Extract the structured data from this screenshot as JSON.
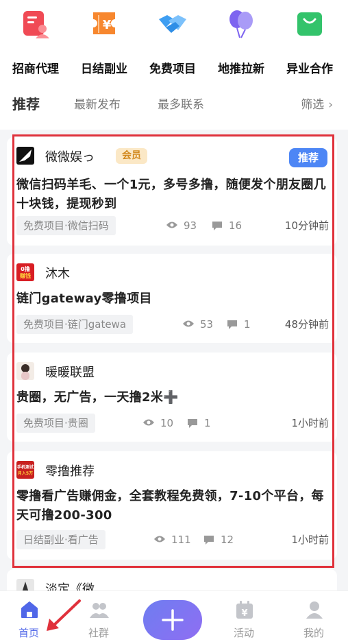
{
  "categories": [
    {
      "label": "招商代理",
      "icon": "merchant-agent-icon",
      "color": "#f04a55"
    },
    {
      "label": "日结副业",
      "icon": "daily-pay-ticket-icon",
      "color": "#f7872e"
    },
    {
      "label": "免费项目",
      "icon": "handshake-icon",
      "color": "#3e9ef2"
    },
    {
      "label": "地推拉新",
      "icon": "balloons-icon",
      "color": "#7d64f0"
    },
    {
      "label": "异业合作",
      "icon": "shopping-bag-icon",
      "color": "#33c36b"
    }
  ],
  "tabs": {
    "recommend": "推荐",
    "latest": "最新发布",
    "most_contact": "最多联系",
    "filter": "筛选"
  },
  "posts": [
    {
      "author": "微微娱っ",
      "vip_label": "会员",
      "rec_label": "推荐",
      "title": "微信扫码羊毛、一个1元，多号多撸，随便发个朋友圈几十块钱，提现秒到",
      "tag": "免费项目·微信扫码",
      "views": "93",
      "comments": "16",
      "time": "10分钟前"
    },
    {
      "author": "沐木",
      "avatar_text": "0撸赚钱",
      "title": "链门gateway零撸项目",
      "tag": "免费项目·链门gatewa",
      "views": "53",
      "comments": "1",
      "time": "48分钟前"
    },
    {
      "author": "暖暖联盟",
      "title": "贵圈，无广告，一天撸2米➕",
      "tag": "免费项目·贵圈",
      "views": "10",
      "comments": "1",
      "time": "1小时前"
    },
    {
      "author": "零撸推荐",
      "avatar_text": "手机测试 月入5万",
      "title": "零撸看广告赚佣金，全套教程免费领，7-10个平台，每天可撸200-300",
      "tag": "日结副业·看广告",
      "views": "111",
      "comments": "12",
      "time": "1小时前"
    },
    {
      "author": "淡定《微"
    }
  ],
  "nav": {
    "home": "首页",
    "community": "社群",
    "activity": "活动",
    "mine": "我的"
  },
  "colors": {
    "accent": "#5067e8",
    "rec_badge": "#4d86f5",
    "highlight": "#e0313b"
  }
}
